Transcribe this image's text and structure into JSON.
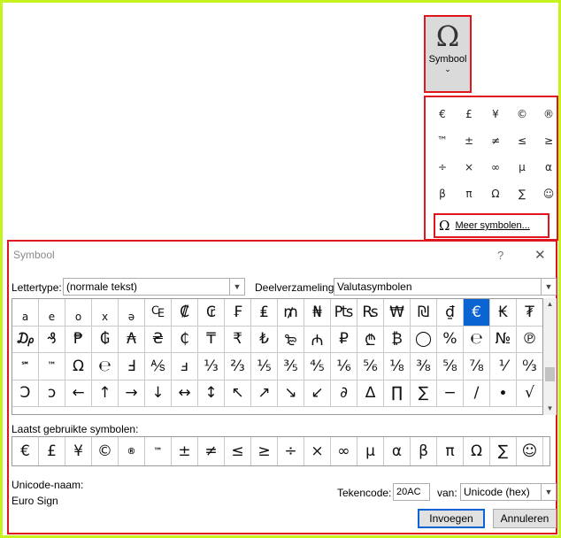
{
  "ribbon": {
    "symbol_button": {
      "icon": "omega-icon",
      "glyph": "Ω",
      "label": "Symbool",
      "chevron": "⌄"
    }
  },
  "gallery": {
    "items": [
      "€",
      "£",
      "¥",
      "©",
      "®",
      "™",
      "±",
      "≠",
      "≤",
      "≥",
      "÷",
      "×",
      "∞",
      "µ",
      "α",
      "β",
      "π",
      "Ω",
      "∑",
      "☺"
    ],
    "more_button": {
      "glyph": "Ω",
      "label": "Meer symbolen..."
    }
  },
  "dialog": {
    "title": "Symbool",
    "help": "?",
    "close": "✕",
    "font_label": "Lettertype:",
    "font_value": "(normale tekst)",
    "subset_label": "Deelverzameling:",
    "subset_value": "Valutasymbolen",
    "grid_rows": [
      [
        "a",
        "e",
        "o",
        "x",
        "ə",
        "₠",
        "₡",
        "₢",
        "₣",
        "₤",
        "₥",
        "₦",
        "₧",
        "₨",
        "₩",
        "₪",
        "₫",
        "€",
        "₭",
        "₮"
      ],
      [
        "₯",
        "₰",
        "₱",
        "₲",
        "₳",
        "₴",
        "₵",
        "₸",
        "₹",
        "₺",
        "₻",
        "₼",
        "₽",
        "₾",
        "₿",
        "◯",
        "%",
        "℮",
        "№",
        "℗"
      ],
      [
        "℠",
        "™",
        "Ω",
        "℮",
        "Ⅎ",
        "⅍",
        "ⅎ",
        "⅓",
        "⅔",
        "⅕",
        "⅗",
        "⅘",
        "⅙",
        "⅚",
        "⅛",
        "⅜",
        "⅝",
        "⅞",
        "⅟",
        "↉"
      ],
      [
        "Ↄ",
        "ↄ",
        "←",
        "↑",
        "→",
        "↓",
        "↔",
        "↕",
        "↖",
        "↗",
        "↘",
        "↙",
        "∂",
        "∆",
        "∏",
        "∑",
        "−",
        "∕",
        "∙",
        "√"
      ]
    ],
    "selected_symbol": "€",
    "recent_label": "Laatst gebruikte symbolen:",
    "recent": [
      "€",
      "£",
      "¥",
      "©",
      "®",
      "™",
      "±",
      "≠",
      "≤",
      "≥",
      "÷",
      "×",
      "∞",
      "µ",
      "α",
      "β",
      "π",
      "Ω",
      "∑",
      "☺"
    ],
    "unicode_name_label": "Unicode-naam:",
    "unicode_name_value": "Euro Sign",
    "charcode_label": "Tekencode:",
    "charcode_value": "20AC",
    "from_label": "van:",
    "from_value": "Unicode (hex)",
    "insert_button": "Invoegen",
    "cancel_button": "Annuleren"
  }
}
